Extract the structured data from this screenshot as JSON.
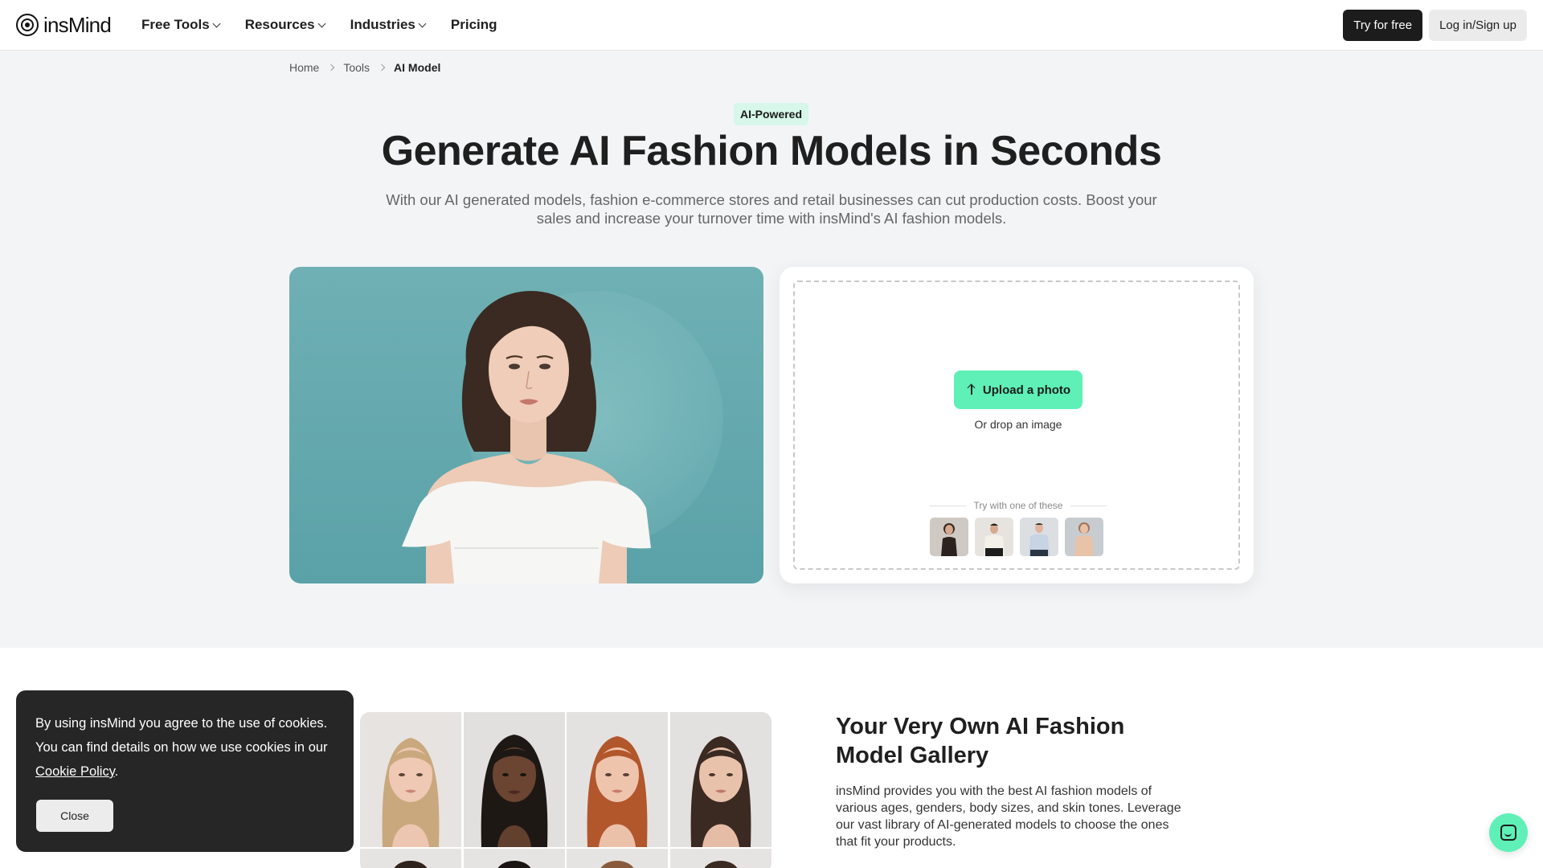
{
  "header": {
    "logo_text": "insMind",
    "nav": [
      {
        "label": "Free Tools",
        "has_dropdown": true
      },
      {
        "label": "Resources",
        "has_dropdown": true
      },
      {
        "label": "Industries",
        "has_dropdown": true
      },
      {
        "label": "Pricing",
        "has_dropdown": false
      }
    ],
    "try_label": "Try for free",
    "login_label": "Log in/Sign up"
  },
  "breadcrumb": {
    "items": [
      "Home",
      "Tools"
    ],
    "current": "AI Model"
  },
  "hero": {
    "badge": "AI-Powered",
    "title": "Generate AI Fashion Models in Seconds",
    "subtitle": "With our AI generated models, fashion e-commerce stores and retail businesses can cut production costs. Boost your sales and increase your turnover time with insMind's AI fashion models."
  },
  "upload": {
    "button_label": "Upload a photo",
    "drop_text": "Or drop an image",
    "try_label": "Try with one of these"
  },
  "gallery": {
    "title": "Your Very Own AI Fashion Model Gallery",
    "text": "insMind provides you with the best AI fashion models of various ages, genders, body sizes, and skin tones. Leverage our vast library of AI-generated models to choose the ones that fit your products."
  },
  "cookie": {
    "text_before": "By using insMind you agree to the use of cookies. You can find details on how we use cookies in our ",
    "link": "Cookie Policy",
    "text_after": ".",
    "close_label": "Close"
  },
  "colors": {
    "accent": "#5ef0b7",
    "badge_bg": "#d6f7ea",
    "dark": "#1c1c1c"
  },
  "icons": [
    "logo-icon",
    "chevron-down-icon",
    "chevron-right-icon",
    "upload-icon",
    "chat-icon"
  ]
}
